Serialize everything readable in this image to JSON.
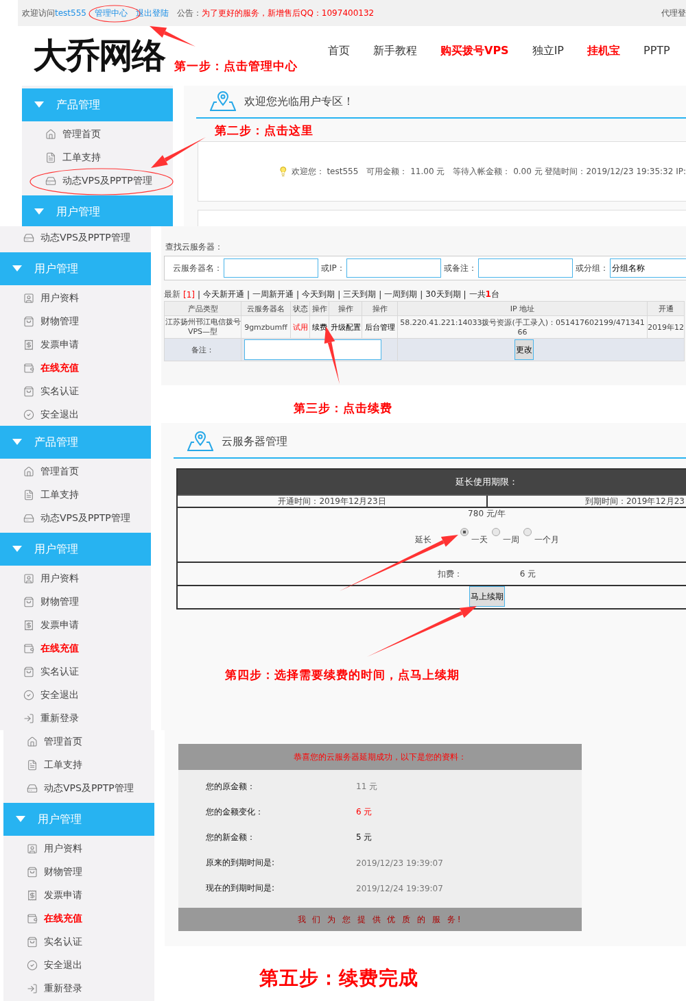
{
  "header": {
    "greeting": "欢迎访问",
    "username": "test555",
    "links": [
      "管理中心",
      "退出登陆"
    ],
    "notice_label": "公告：",
    "notice": "为了更好的服务，新增售后QQ：1097400132",
    "agent_link": "代理登",
    "logo": "大乔网络",
    "annotation": "第一步：点击管理中心",
    "nav": [
      {
        "label": "首页",
        "hot": false
      },
      {
        "label": "新手教程",
        "hot": false
      },
      {
        "label": "购买拨号VPS",
        "hot": true
      },
      {
        "label": "独立IP",
        "hot": false
      },
      {
        "label": "挂机宝",
        "hot": true
      },
      {
        "label": "PPTP",
        "hot": false
      }
    ]
  },
  "welcome_step": {
    "sidebar": [
      {
        "kind": "group",
        "title": "产品管理",
        "items": [
          {
            "label": "管理首页",
            "kind": "home",
            "hot": false
          },
          {
            "label": "工单支持",
            "kind": "ticket",
            "hot": false
          },
          {
            "label": "动态VPS及PPTP管理",
            "kind": "vps",
            "hot": false
          }
        ]
      },
      {
        "kind": "group",
        "title": "用户管理"
      }
    ],
    "title": "欢迎您光临用户专区！",
    "annotation": "第二步：点击这里",
    "info": "欢迎您： test555　可用金额： 11.00 元　等待入帐金额： 0.00 元 登陆时间：2019/12/23 19:35:32 IP:"
  },
  "search_step": {
    "sidebar": [
      {
        "kind": "loose",
        "items": [
          {
            "label": "动态VPS及PPTP管理",
            "kind": "vps",
            "hot": false
          }
        ]
      },
      {
        "kind": "group",
        "title": "用户管理",
        "items": [
          {
            "label": "用户资料",
            "kind": "profile",
            "hot": false
          },
          {
            "label": "财物管理",
            "kind": "bag",
            "hot": false
          },
          {
            "label": "发票申请",
            "kind": "invoice",
            "hot": false
          },
          {
            "label": "在线充值",
            "kind": "wallet",
            "hot": true
          },
          {
            "label": "实名认证",
            "kind": "bag",
            "hot": false
          },
          {
            "label": "安全退出",
            "kind": "logout",
            "hot": false
          }
        ]
      }
    ],
    "search_label": "查找云服务器：",
    "fields": [
      {
        "label": "云服务器名："
      },
      {
        "label": "或IP："
      },
      {
        "label": "或备注："
      },
      {
        "label": "或分组：",
        "value": "分组名称"
      }
    ],
    "latest": "最新",
    "latest_count": "[1]",
    "separator": "|",
    "filters": [
      "今天新开通",
      "一周新开通",
      "今天到期",
      "三天到期",
      "一周到期",
      "30天到期"
    ],
    "total": "一共**1**台",
    "columns": [
      "产品类型",
      "云服务器名",
      "状态",
      "操作",
      "操作",
      "操作",
      "IP 地址",
      "开通"
    ],
    "row": {
      "product": "江苏扬州邗江电信拨号VPS—型",
      "name": "9gmzbumff",
      "status": "试用",
      "actions": [
        "续费",
        "升级配置",
        "后台管理"
      ],
      "ip": "58.220.41.221:14033拨号资源(手工录入)：051417602199/47134166",
      "opened": "2019年12"
    },
    "note_label": "备注：",
    "note_button": "更改",
    "annotation": "第三步：点击续费"
  },
  "renew_step": {
    "sidebar": [
      {
        "kind": "group",
        "title": "产品管理",
        "items": [
          {
            "label": "管理首页",
            "kind": "home",
            "hot": false
          },
          {
            "label": "工单支持",
            "kind": "ticket",
            "hot": false
          },
          {
            "label": "动态VPS及PPTP管理",
            "kind": "vps",
            "hot": false
          }
        ]
      },
      {
        "kind": "group",
        "title": "用户管理",
        "items": [
          {
            "label": "用户资料",
            "kind": "profile",
            "hot": false
          },
          {
            "label": "财物管理",
            "kind": "bag",
            "hot": false
          },
          {
            "label": "发票申请",
            "kind": "invoice",
            "hot": false
          },
          {
            "label": "在线充值",
            "kind": "wallet",
            "hot": true
          },
          {
            "label": "实名认证",
            "kind": "bag",
            "hot": false
          },
          {
            "label": "安全退出",
            "kind": "logout",
            "hot": false
          },
          {
            "label": "重新登录",
            "kind": "relogin",
            "hot": false
          }
        ]
      }
    ],
    "title": "云服务器管理",
    "panel_title": "延长使用期限：",
    "opened": "开通时间：2019年12月23日",
    "expires": "到期时间：2019年12月23",
    "price": "780 元/年",
    "extend_label": "延长",
    "options": [
      {
        "label": "一天",
        "selected": true
      },
      {
        "label": "一周",
        "selected": false
      },
      {
        "label": "一个月",
        "selected": false
      }
    ],
    "fee_label": "扣费：",
    "fee": "6 元",
    "button": "马上续期",
    "annotation": "第四步：选择需要续费的时间，点马上续期"
  },
  "result_step": {
    "sidebar": [
      {
        "kind": "loose",
        "items": [
          {
            "label": "管理首页",
            "kind": "home",
            "hot": false
          },
          {
            "label": "工单支持",
            "kind": "ticket",
            "hot": false
          },
          {
            "label": "动态VPS及PPTP管理",
            "kind": "vps",
            "hot": false
          }
        ]
      },
      {
        "kind": "group",
        "title": "用户管理",
        "items": [
          {
            "label": "用户资料",
            "kind": "profile",
            "hot": false
          },
          {
            "label": "财物管理",
            "kind": "bag",
            "hot": false
          },
          {
            "label": "发票申请",
            "kind": "invoice",
            "hot": false
          },
          {
            "label": "在线充值",
            "kind": "wallet",
            "hot": true
          },
          {
            "label": "实名认证",
            "kind": "bag",
            "hot": false
          },
          {
            "label": "安全退出",
            "kind": "logout",
            "hot": false
          },
          {
            "label": "重新登录",
            "kind": "relogin",
            "hot": false
          }
        ]
      }
    ],
    "panel_title": "恭喜您的云服务器延期成功，以下是您的资料：",
    "rows": [
      {
        "label": "您的原金额：",
        "value": "11 元",
        "color": "#777777"
      },
      {
        "label": "您的金额变化：",
        "value": "6 元",
        "color": "#ff0000"
      },
      {
        "label": "您的新金额：",
        "value": "5 元",
        "color": "#111111"
      },
      {
        "label": "原来的到期时间是:",
        "value": "2019/12/23 19:39:07",
        "color": "#777777"
      },
      {
        "label": "现在的到期时间是:",
        "value": "2019/12/24 19:39:07",
        "color": "#777777"
      }
    ],
    "footer": "我 们 为 您 提 供 优 质 的 服 务!",
    "annotation": "第五步：续费完成"
  }
}
